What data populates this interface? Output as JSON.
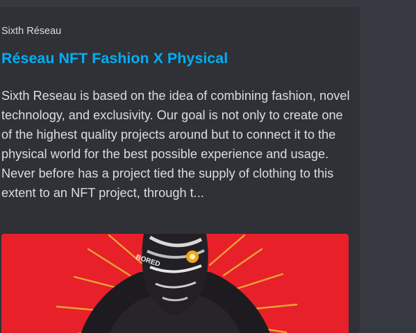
{
  "embed": {
    "provider": "Sixth Réseau",
    "title": "Réseau NFT Fashion X Physical",
    "description": "Sixth Reseau is based on the idea of combining fashion, novel technology, and exclusivity. Our goal is not only to create one of the highest quality projects around but to connect it to the physical world for the best possible experience and usage. Never before has a project tied the supply of clothing to this extent to an NFT project, through t...",
    "image_text": "BORED",
    "accent_color": "#00aff4"
  }
}
